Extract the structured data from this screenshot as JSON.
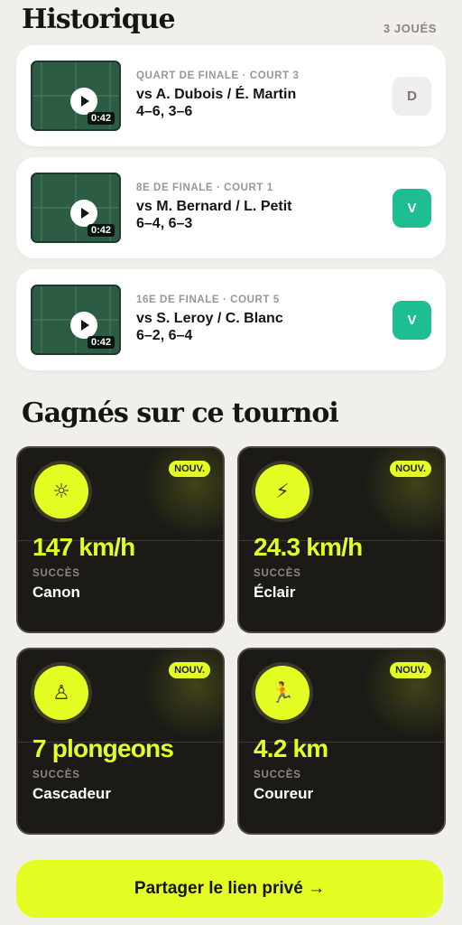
{
  "history": {
    "title": "Historique",
    "count": "3 JOUÉS",
    "matches": [
      {
        "round": "QUART DE FINALE · COURT 3",
        "opponent": "vs A. Dubois / É. Martin",
        "score": "4–6, 3–6",
        "duration": "0:42",
        "result": "D"
      },
      {
        "round": "8E DE FINALE · COURT 1",
        "opponent": "vs M. Bernard / L. Petit",
        "score": "6–4, 6–3",
        "duration": "0:42",
        "result": "V"
      },
      {
        "round": "16E DE FINALE · COURT 5",
        "opponent": "vs S. Leroy / C. Blanc",
        "score": "6–2, 6–4",
        "duration": "0:42",
        "result": "V"
      }
    ]
  },
  "earned": {
    "title": "Gagnés sur ce tournoi",
    "achievements": [
      {
        "icon": "sun-icon",
        "glyph": "☼",
        "badge": "NOUV.",
        "value": "147 km/h",
        "kind": "SUCCÈS",
        "name": "Canon"
      },
      {
        "icon": "lightning-icon",
        "glyph": "⚡",
        "badge": "NOUV.",
        "value": "24.3 km/h",
        "kind": "SUCCÈS",
        "name": "Éclair"
      },
      {
        "icon": "diver-icon",
        "glyph": "♙",
        "badge": "NOUV.",
        "value": "7 plongeons",
        "kind": "SUCCÈS",
        "name": "Cascadeur"
      },
      {
        "icon": "runner-icon",
        "glyph": "🏃",
        "badge": "NOUV.",
        "value": "4.2 km",
        "kind": "SUCCÈS",
        "name": "Coureur"
      }
    ]
  },
  "share": {
    "label": "Partager le lien privé →"
  },
  "colors": {
    "accent": "#e4fd23",
    "win": "#1cbe92",
    "card_dark": "#1b1a16",
    "court": "#2d5c44"
  }
}
